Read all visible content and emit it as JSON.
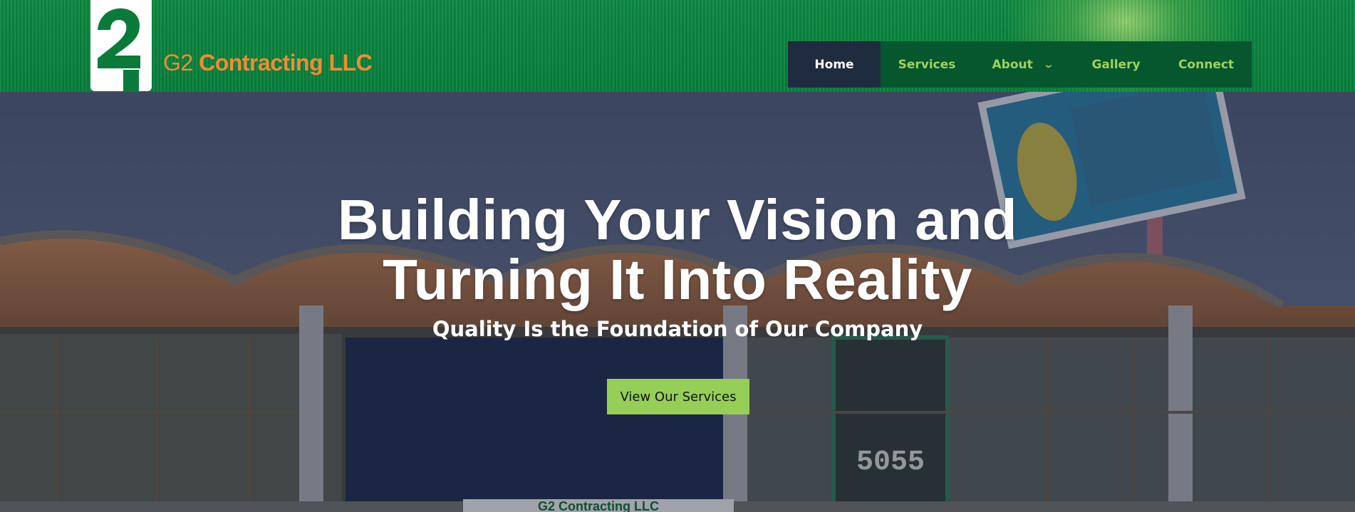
{
  "brand": {
    "logo_glyph": "2",
    "name_prefix": "G2",
    "name_rest": " Contracting LLC",
    "accent_color": "#f08c35",
    "header_color": "#0d8a42"
  },
  "nav": {
    "items": [
      {
        "label": "Home",
        "active": true
      },
      {
        "label": "Services"
      },
      {
        "label": "About",
        "icon": "chevron-down-icon"
      },
      {
        "label": "Gallery"
      },
      {
        "label": "Connect"
      }
    ]
  },
  "hero": {
    "headline_line1": "Building Your Vision and",
    "headline_line2": "Turning It Into Reality",
    "subheadline": "Quality Is the Foundation of Our Company",
    "cta_label": "View Our Services",
    "cta_color": "#95cf57"
  },
  "background_photo": {
    "sign_text": "5055",
    "banner_text": "G2 Contracting LLC"
  }
}
